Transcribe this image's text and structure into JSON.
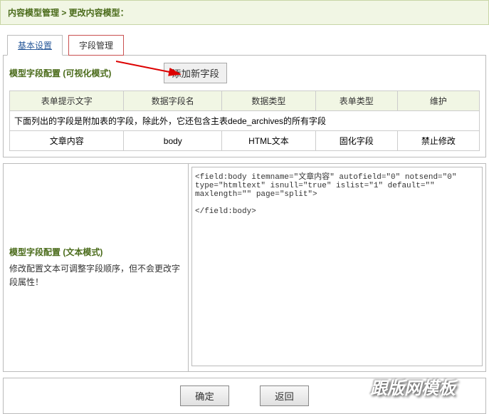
{
  "breadcrumb": "内容模型管理 > 更改内容模型：",
  "tabs": {
    "basic": "基本设置",
    "fields": "字段管理"
  },
  "visual_config_title": "模型字段配置 (可视化模式)",
  "add_field_btn": "添加新字段",
  "table": {
    "headers": {
      "prompt": "表单提示文字",
      "field": "数据字段名",
      "type": "数据类型",
      "form_type": "表单类型",
      "maintain": "维护"
    },
    "note": "下面列出的字段是附加表的字段，除此外，它还包含主表dede_archives的所有字段",
    "row": {
      "prompt": "文章内容",
      "field": "body",
      "type": "HTML文本",
      "form_type": "固化字段",
      "maintain": "禁止修改"
    }
  },
  "text_config": {
    "title": "模型字段配置 (文本模式)",
    "desc": "修改配置文本可调整字段顺序，但不会更改字段属性！",
    "code": "<field:body itemname=\"文章内容\" autofield=\"0\" notsend=\"0\" type=\"htmltext\" isnull=\"true\" islist=\"1\" default=\"\" maxlength=\"\" page=\"split\">\n\n</field:body>"
  },
  "buttons": {
    "confirm": "确定",
    "back": "返回"
  },
  "watermark": "跟版网模板"
}
